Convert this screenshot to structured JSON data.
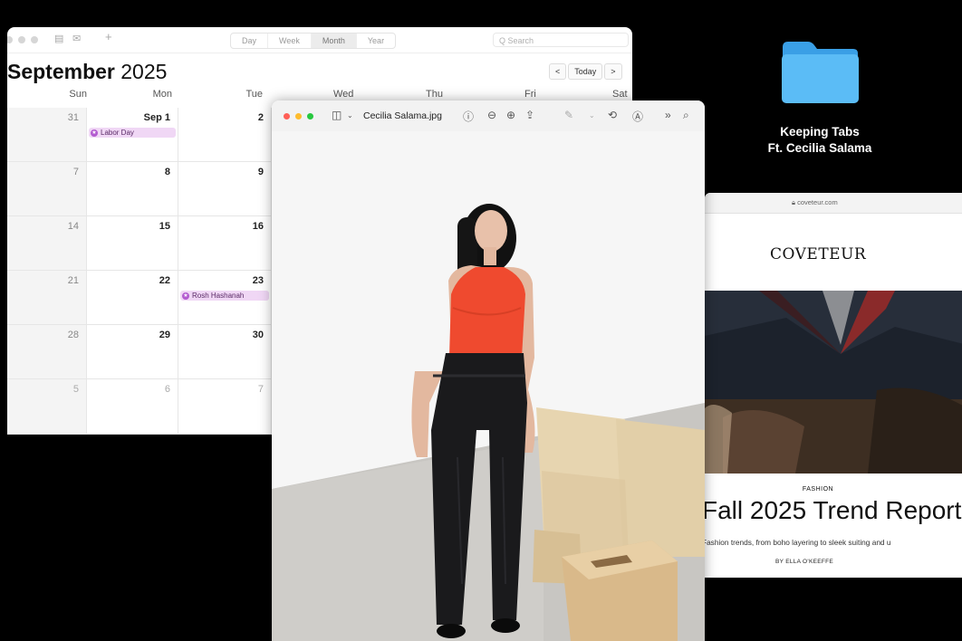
{
  "calendar": {
    "views": [
      "Day",
      "Week",
      "Month",
      "Year"
    ],
    "selected_view": "Month",
    "search_placeholder": "Q Search",
    "month": "September",
    "year": "2025",
    "today_label": "Today",
    "prev_label": "<",
    "next_label": ">",
    "weekdays": [
      "Sun",
      "Mon",
      "Tue",
      "Wed",
      "Thu",
      "Fri",
      "Sat"
    ],
    "weeks": [
      [
        "31",
        "Sep 1",
        "2"
      ],
      [
        "7",
        "8",
        "9"
      ],
      [
        "14",
        "15",
        "16"
      ],
      [
        "21",
        "22",
        "23"
      ],
      [
        "28",
        "29",
        "30"
      ],
      [
        "5",
        "6",
        "7"
      ]
    ],
    "events": {
      "labor_day": "Labor Day",
      "rosh_hashanah": "Rosh Hashanah"
    },
    "event_color": "#f0d7f5"
  },
  "preview": {
    "filename": "Cecilia Salama.jpg"
  },
  "desktop": {
    "folder_line1": "Keeping Tabs",
    "folder_line2": "Ft. Cecilia Salama",
    "folder_color": "#4fb3f3"
  },
  "safari": {
    "url": "coveteur.com",
    "logo": "COVETEUR",
    "category": "FASHION",
    "headline": "Fall 2025 Trend Report",
    "subhead": "Fashion trends, from boho layering to sleek suiting and u",
    "byline": "BY ELLA O'KEEFFE"
  }
}
